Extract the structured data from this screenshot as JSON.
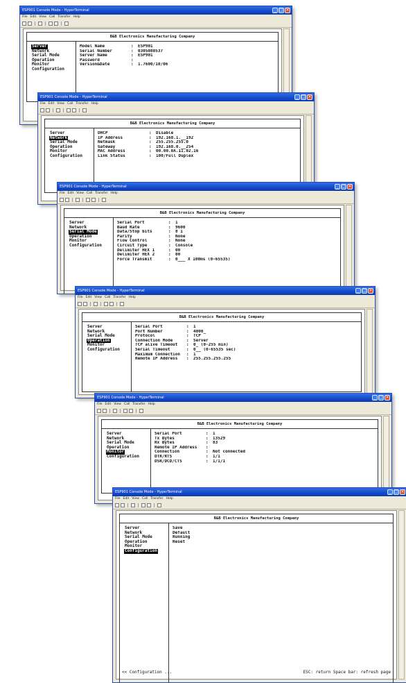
{
  "window_title": "ESP901 Console Mode - HyperTerminal",
  "menu": [
    "File",
    "Edit",
    "View",
    "Call",
    "Transfer",
    "Help"
  ],
  "company": "B&B Electronics Manufacturing Company",
  "side_menu": [
    "Server",
    "Network",
    "Serial Mode",
    "Operation",
    "Monitor",
    "Configuration"
  ],
  "windows": [
    {
      "selected": 0,
      "fields": [
        {
          "k": "Model Name",
          "v": "ESP901"
        },
        {
          "k": "Serial Number",
          "v": "0305080537"
        },
        {
          "k": "Server Name",
          "v": "ESP901"
        },
        {
          "k": "Password",
          "v": ""
        },
        {
          "k": "Version&Date",
          "v": "1.7600/10/06"
        }
      ]
    },
    {
      "selected": 1,
      "fields": [
        {
          "k": "DHCP",
          "v": "Disable"
        },
        {
          "k": "IP Address",
          "v": "192.168.1.__192"
        },
        {
          "k": "Netmask",
          "v": "255.255.255.0"
        },
        {
          "k": "Gateway",
          "v": "192.168.0.__254"
        },
        {
          "k": "MAC Address",
          "v": "00.00.0A.11.02.16"
        },
        {
          "k": "Link Status",
          "v": "100/Full Duplex"
        }
      ]
    },
    {
      "selected": 2,
      "fields": [
        {
          "k": "Serial Port",
          "v": "1"
        },
        {
          "k": "Baud Rate",
          "v": "9600"
        },
        {
          "k": "Data/Stop bits",
          "v": "8 1"
        },
        {
          "k": "Parity",
          "v": "None"
        },
        {
          "k": "Flow Control",
          "v": "None"
        },
        {
          "k": "Circuit Type",
          "v": "Console"
        },
        {
          "k": "Delimiter HEX 1",
          "v": "00"
        },
        {
          "k": "Delimiter HEX 2",
          "v": "00"
        },
        {
          "k": "Force Transmit",
          "v": "0___ X 100ms (0-65535)"
        }
      ]
    },
    {
      "selected": 3,
      "fields": [
        {
          "k": "Serial Port",
          "v": "1"
        },
        {
          "k": "Port Number",
          "v": "4000_"
        },
        {
          "k": "Protocol",
          "v": "TCP"
        },
        {
          "k": "Connection Mode",
          "v": "Server"
        },
        {
          "k": "TCP alive Timeout",
          "v": "0_ (0-255 min)"
        },
        {
          "k": "Serial Timeout",
          "v": "0__ (0-65535 sec)"
        },
        {
          "k": "Maximum Connection",
          "v": "1"
        },
        {
          "k": "Remote IP Address",
          "v": "255.255.255.255"
        }
      ]
    },
    {
      "selected": 4,
      "fields": [
        {
          "k": "Serial Port",
          "v": "1"
        },
        {
          "k": "Tx Bytes",
          "v": "13529"
        },
        {
          "k": "Rx Bytes",
          "v": "83"
        },
        {
          "k": "Remote IP Address",
          "v": ""
        },
        {
          "k": "Connection",
          "v": "Not connected"
        },
        {
          "k": "DTR/RTS",
          "v": "1/1"
        },
        {
          "k": "DSR/DCD/CTS",
          "v": "1/1/1"
        }
      ]
    },
    {
      "selected": 5,
      "fields": [
        {
          "k": "Save",
          "v": ""
        },
        {
          "k": "Default",
          "v": ""
        },
        {
          "k": "Running",
          "v": ""
        },
        {
          "k": "Reset",
          "v": ""
        }
      ],
      "footer_left": "<< Configuration ...",
      "footer_right": "ESC: return  Space bar: refresh page"
    }
  ]
}
